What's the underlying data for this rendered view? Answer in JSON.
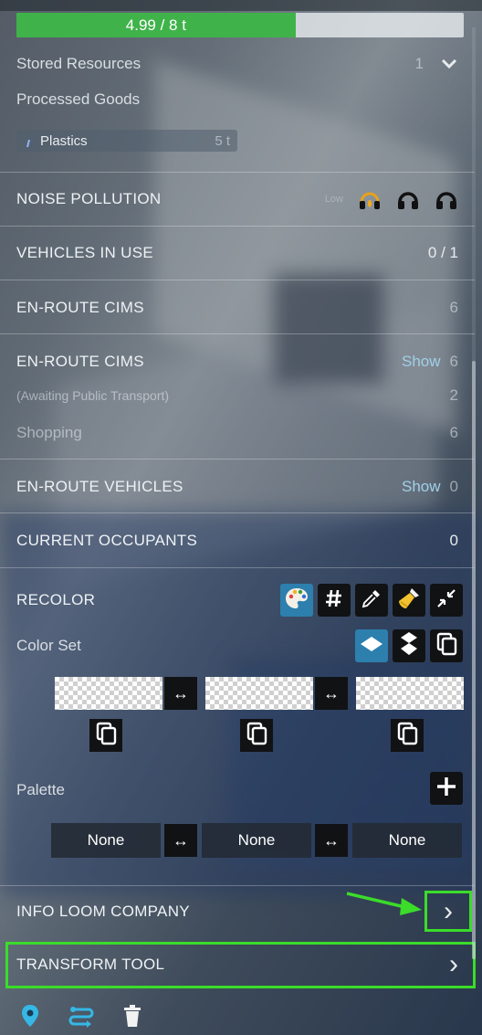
{
  "capacity": {
    "text": "4.99 / 8 t",
    "fraction": 0.624,
    "fill_color": "#3fb34a"
  },
  "storage": {
    "stored_resources_label": "Stored Resources",
    "stored_resources_count": "1",
    "processed_goods_label": "Processed Goods",
    "resource_chip": {
      "name": "Plastics",
      "amount": "5 t",
      "icon": "plastics-icon"
    }
  },
  "noise": {
    "title": "NOISE POLLUTION",
    "level_label": "Low",
    "icons": [
      "headphones-active-icon",
      "headphones-icon",
      "headphones-icon"
    ]
  },
  "vehicles_in_use": {
    "title": "VEHICLES IN USE",
    "value": "0 / 1"
  },
  "enroute_cims_1": {
    "title": "EN-ROUTE CIMS",
    "value": "6"
  },
  "enroute_cims_2": {
    "title": "EN-ROUTE CIMS",
    "show_label": "Show",
    "value": "6",
    "awaiting_label": "(Awaiting Public Transport)",
    "awaiting_value": "2",
    "shopping_label": "Shopping",
    "shopping_value": "6"
  },
  "enroute_vehicles": {
    "title": "EN-ROUTE VEHICLES",
    "show_label": "Show",
    "value": "0"
  },
  "current_occupants": {
    "title": "CURRENT OCCUPANTS",
    "value": "0"
  },
  "recolor": {
    "title": "RECOLOR",
    "tools": [
      "palette-icon",
      "hash-icon",
      "eyedropper-icon",
      "paint-brush-icon",
      "collapse-icon"
    ],
    "color_set_label": "Color Set",
    "color_set_tools": [
      "single-instance-icon",
      "multi-instance-icon",
      "copy-icon"
    ],
    "swap_glyph": "↔",
    "palette_label": "Palette",
    "palette_values": [
      "None",
      "None",
      "None"
    ]
  },
  "info_loom": {
    "title": "INFO LOOM COMPANY",
    "chevron": "›"
  },
  "transform_tool": {
    "title": "TRANSFORM TOOL",
    "chevron": "›"
  },
  "bottom_bar": {
    "icons": [
      "location-pin-icon",
      "route-icon",
      "trash-icon"
    ]
  },
  "colors": {
    "highlight": "#3bdc2a",
    "accent_blue": "#2d7fad",
    "link": "#9fd0e8"
  }
}
